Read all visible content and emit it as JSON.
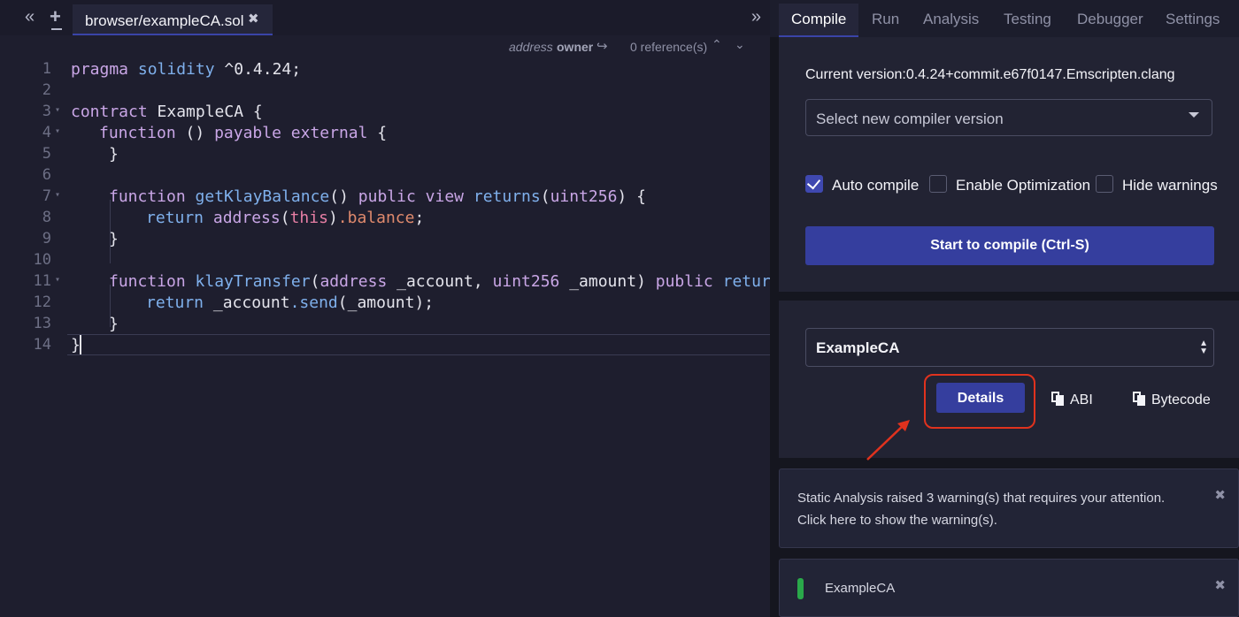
{
  "editor": {
    "tab_title": "browser/exampleCA.sol",
    "collapse_glyph": "«",
    "new_file_glyph": "+",
    "expand_glyph": "»",
    "close_glyph": "✖",
    "references": {
      "type": "address",
      "name": "owner",
      "count_text": "0 reference(s)",
      "arrow_glyph": "↪",
      "up_glyph": "⌃",
      "down_glyph": "⌄"
    },
    "line_numbers": [
      "1",
      "2",
      "3",
      "4",
      "5",
      "6",
      "7",
      "8",
      "9",
      "10",
      "11",
      "12",
      "13",
      "14"
    ],
    "code": {
      "l1_kw": "pragma",
      "l1_ty": "solidity",
      "l1_rest": " ^0.4.24;",
      "l3_kw": "contract",
      "l3_rest": " ExampleCA {",
      "l4_fn": "function",
      "l4_mid": " () ",
      "l4_kw1": "payable",
      "l4_kw2": "external",
      "l4_end": " {",
      "l5": "}",
      "l7_fn": "function",
      "l7_name": "getKlayBalance",
      "l7_mid": "() ",
      "l7_kw1": "public",
      "l7_kw2": "view",
      "l7_kw3": "returns",
      "l7_open": "(",
      "l7_ty": "uint256",
      "l7_end": ") {",
      "l8_kw": "return",
      "l8_addr": "address",
      "l8_open": "(",
      "l8_this": "this",
      "l8_close": ")",
      "l8_bal": ".balance",
      "l8_end": ";",
      "l9": "}",
      "l11_fn": "function",
      "l11_name": "klayTransfer",
      "l11_open": "(",
      "l11_ty1": "address",
      "l11_arg1": " _account, ",
      "l11_ty2": "uint256",
      "l11_arg2": " _amount) ",
      "l11_kw1": "public",
      "l11_kw2": "returns",
      "l12_kw": "return",
      "l12_acct": " _account",
      "l12_send": ".send",
      "l12_end": "(_amount);",
      "l13": "}",
      "l14": "}"
    }
  },
  "panel": {
    "tabs": [
      "Compile",
      "Run",
      "Analysis",
      "Testing",
      "Debugger",
      "Settings"
    ],
    "current_version": "Current version:0.4.24+commit.e67f0147.Emscripten.clang",
    "version_select_placeholder": "Select new compiler version",
    "checkboxes": {
      "auto_compile": {
        "label": "Auto compile",
        "checked": true
      },
      "enable_optimization": {
        "label": "Enable Optimization",
        "checked": false
      },
      "hide_warnings": {
        "label": "Hide warnings",
        "checked": false
      }
    },
    "compile_button": "Start to compile (Ctrl-S)",
    "contract_select": "ExampleCA",
    "details_button": "Details",
    "abi_button": "ABI",
    "bytecode_button": "Bytecode",
    "warning": {
      "line1": "Static Analysis raised 3 warning(s) that requires your attention.",
      "line2": "Click here to show the warning(s)."
    },
    "status": {
      "label": "ExampleCA",
      "status_color": "#2aa84a"
    },
    "close_glyph": "✖",
    "updown_up": "▲",
    "updown_down": "▼"
  },
  "colors": {
    "accent": "#353e9e",
    "highlight_ring": "#e0321e",
    "background": "#1e1e2e"
  },
  "icons": [
    "collapse-left-icon",
    "new-file-icon",
    "expand-right-icon",
    "close-icon",
    "reply-arrow-icon",
    "chevron-up-icon",
    "chevron-down-icon",
    "check-icon",
    "caret-down-icon",
    "clipboard-icon",
    "red-pointer-arrow"
  ]
}
